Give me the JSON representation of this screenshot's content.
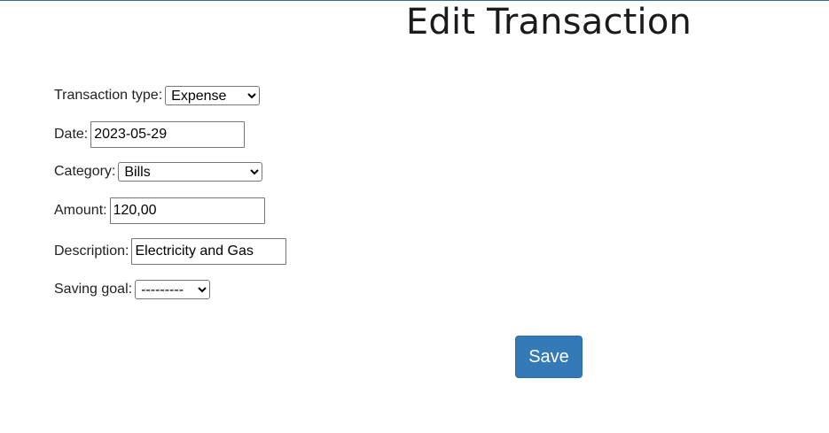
{
  "page": {
    "title": "Edit Transaction"
  },
  "form": {
    "transaction_type": {
      "label": "Transaction type:",
      "selected": "Expense"
    },
    "date": {
      "label": "Date:",
      "value": "2023-05-29"
    },
    "category": {
      "label": "Category:",
      "selected": "Bills"
    },
    "amount": {
      "label": "Amount:",
      "value": "120,00"
    },
    "description": {
      "label": "Description:",
      "value": "Electricity and Gas"
    },
    "saving_goal": {
      "label": "Saving goal:",
      "selected": "---------"
    },
    "save_label": "Save"
  },
  "colors": {
    "accent": "#337ab7",
    "top_line": "#2e6c9e"
  }
}
